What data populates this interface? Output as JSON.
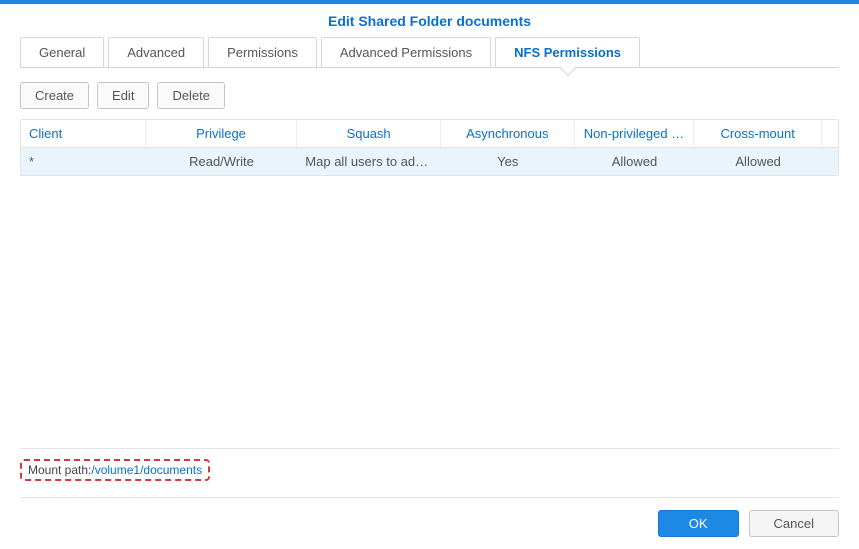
{
  "title": "Edit Shared Folder documents",
  "tabs": [
    {
      "label": "General"
    },
    {
      "label": "Advanced"
    },
    {
      "label": "Permissions"
    },
    {
      "label": "Advanced Permissions"
    },
    {
      "label": "NFS Permissions"
    }
  ],
  "active_tab": "NFS Permissions",
  "toolbar": {
    "create": "Create",
    "edit": "Edit",
    "delete": "Delete"
  },
  "columns": {
    "client": "Client",
    "privilege": "Privilege",
    "squash": "Squash",
    "asynchronous": "Asynchronous",
    "non_privileged": "Non-privileged …",
    "cross_mount": "Cross-mount"
  },
  "rows": [
    {
      "client": "*",
      "privilege": "Read/Write",
      "squash": "Map all users to admin",
      "asynchronous": "Yes",
      "non_privileged": "Allowed",
      "cross_mount": "Allowed"
    }
  ],
  "mount": {
    "label": "Mount path:",
    "path": "/volume1/documents"
  },
  "buttons": {
    "ok": "OK",
    "cancel": "Cancel"
  }
}
